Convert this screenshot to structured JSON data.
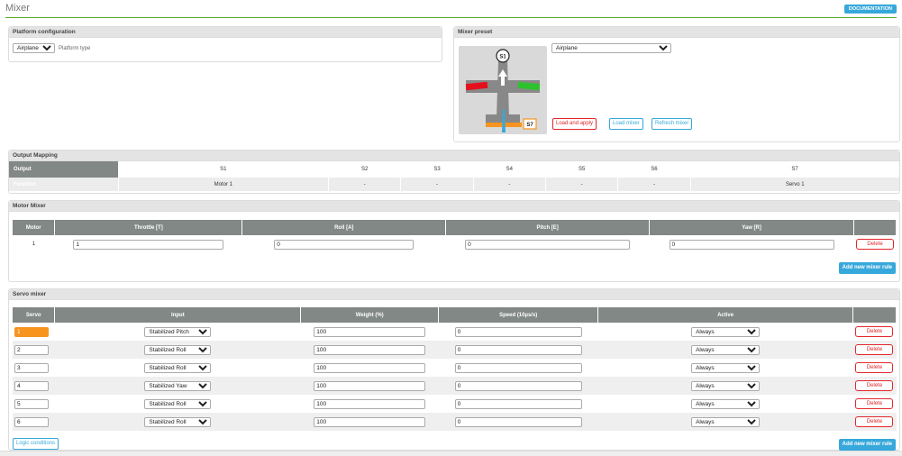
{
  "page": {
    "title": "Mixer",
    "documentation_label": "DOCUMENTATION"
  },
  "platform": {
    "header": "Platform configuration",
    "selected": "Airplane",
    "label": "Platform type"
  },
  "preset": {
    "header": "Mixer preset",
    "selected": "Airplane",
    "diagram": {
      "s1_label": "S1",
      "s7_label": "S7"
    },
    "load_apply": "Load and apply",
    "load_mixer": "Load mixer",
    "refresh_mixer": "Refresh mixer"
  },
  "output_mapping": {
    "header": "Output Mapping",
    "output_label": "Output",
    "function_label": "Function",
    "outputs": [
      "S1",
      "S2",
      "S3",
      "S4",
      "S5",
      "S6",
      "S7"
    ],
    "functions": [
      "Motor 1",
      "-",
      "-",
      "-",
      "-",
      "-",
      "Servo 1"
    ]
  },
  "motor_mixer": {
    "header": "Motor Mixer",
    "columns": [
      "Motor",
      "Throttle [T]",
      "Roll [A]",
      "Pitch [E]",
      "Yaw [R]"
    ],
    "rows": [
      {
        "motor": "1",
        "throttle": "1",
        "roll": "0",
        "pitch": "0",
        "yaw": "0"
      }
    ],
    "delete_label": "Delete",
    "add_rule_label": "Add new mixer rule"
  },
  "servo_mixer": {
    "header": "Servo mixer",
    "columns": [
      "Servo",
      "Input",
      "Weight (%)",
      "Speed (10µs/s)",
      "Active"
    ],
    "rows": [
      {
        "servo": "1",
        "input": "Stabilized Pitch",
        "weight": "100",
        "speed": "0",
        "active": "Always"
      },
      {
        "servo": "2",
        "input": "Stabilized Roll",
        "weight": "100",
        "speed": "0",
        "active": "Always"
      },
      {
        "servo": "3",
        "input": "Stabilized Roll",
        "weight": "100",
        "speed": "0",
        "active": "Always"
      },
      {
        "servo": "4",
        "input": "Stabilized Yaw",
        "weight": "100",
        "speed": "0",
        "active": "Always"
      },
      {
        "servo": "5",
        "input": "Stabilized Roll",
        "weight": "100",
        "speed": "0",
        "active": "Always"
      },
      {
        "servo": "6",
        "input": "Stabilized Roll",
        "weight": "100",
        "speed": "0",
        "active": "Always"
      }
    ],
    "delete_label": "Delete",
    "logic_label": "Logic conditions",
    "add_rule_label": "Add new mixer rule"
  },
  "colors": {
    "accent": "#37a8db",
    "danger": "#e2272b",
    "header_gray": "#828885",
    "highlight": "#f7941e",
    "green_line": "#59aa29"
  }
}
